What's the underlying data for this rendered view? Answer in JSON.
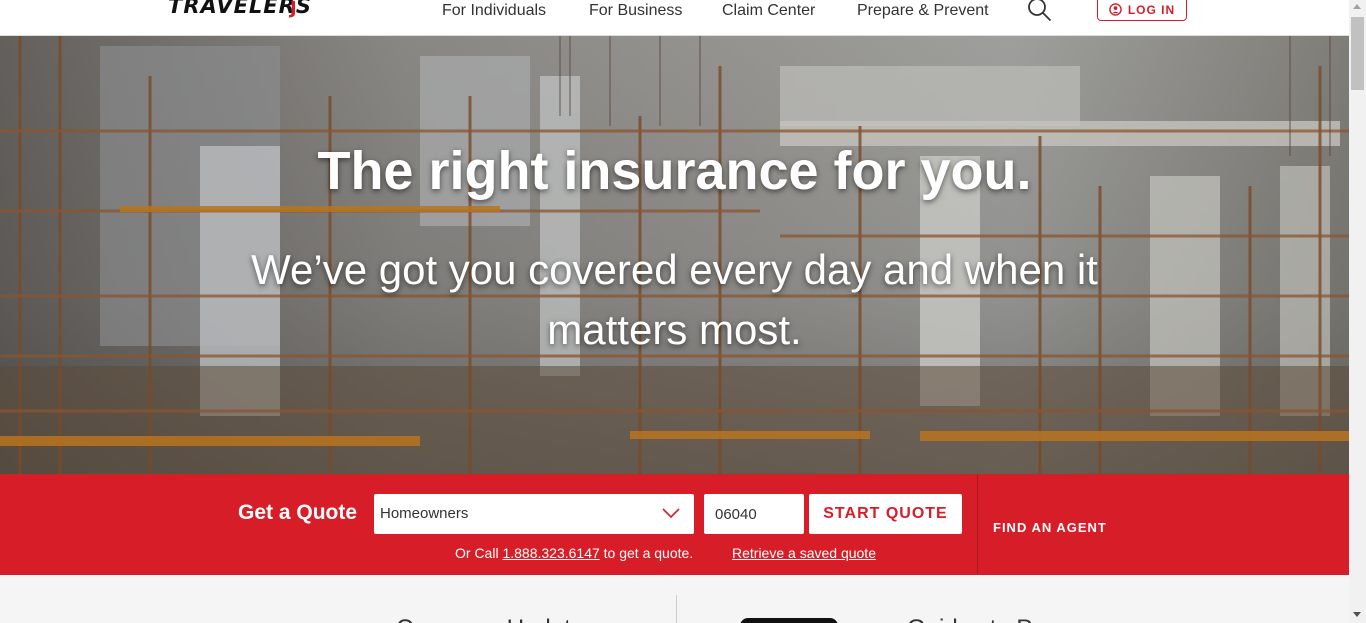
{
  "header": {
    "logo": "TRAVELERS",
    "logo_mark": "J",
    "nav": [
      "For Individuals",
      "For Business",
      "Claim Center",
      "Prepare & Prevent"
    ],
    "search_icon": "search-icon",
    "login_label": "LOG IN",
    "login_icon": "user-circle-icon"
  },
  "hero": {
    "title": "The right insurance for you.",
    "subtitle": "We’ve got you covered every day and when it matters most."
  },
  "quote": {
    "label": "Get a Quote",
    "product_selected": "Homeowners",
    "zip_value": "06040",
    "start_label": "START QUOTE",
    "call_prefix": "Or Call",
    "phone": "1.888.323.6147",
    "call_suffix": "to get a quote.",
    "retrieve_label": "Retrieve a saved quote",
    "find_agent_label": "FIND AN AGENT"
  },
  "below": {
    "left_heading": "Coverage Updates",
    "right_heading": "Guides to Prepare"
  },
  "colors": {
    "brand_red": "#d71e28",
    "nav_text": "#333333"
  }
}
